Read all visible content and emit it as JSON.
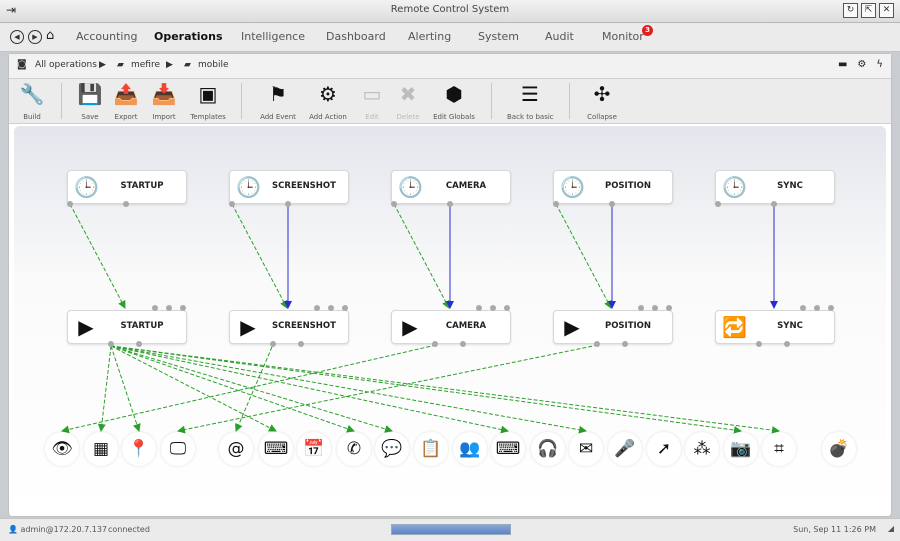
{
  "window": {
    "title": "Remote Control System",
    "controls": [
      "↻",
      "⇱",
      "✕"
    ]
  },
  "menu": {
    "tabs": [
      "Accounting",
      "Operations",
      "Intelligence",
      "Dashboard",
      "Alerting",
      "System",
      "Audit",
      "Monitor"
    ],
    "active": "Operations",
    "monitor_badge": "3"
  },
  "breadcrumb": {
    "root": "All operations",
    "operation": "mefire",
    "target": "mobile"
  },
  "toolbar": {
    "items": [
      {
        "label": "Build",
        "icon": "wrench-icon",
        "enabled": true
      },
      {
        "label": "Save",
        "icon": "floppy-icon",
        "enabled": true
      },
      {
        "label": "Export",
        "icon": "export-icon",
        "enabled": true
      },
      {
        "label": "Import",
        "icon": "import-icon",
        "enabled": true
      },
      {
        "label": "Templates",
        "icon": "templates-icon",
        "enabled": true
      },
      {
        "label": "Add Event",
        "icon": "flag-add-icon",
        "enabled": true
      },
      {
        "label": "Add Action",
        "icon": "gear-add-icon",
        "enabled": true
      },
      {
        "label": "Edit",
        "icon": "edit-icon",
        "enabled": false
      },
      {
        "label": "Delete",
        "icon": "delete-icon",
        "enabled": false
      },
      {
        "label": "Edit Globals",
        "icon": "cube-icon",
        "enabled": true
      },
      {
        "label": "Back to basic",
        "icon": "list-icon",
        "enabled": true
      },
      {
        "label": "Collapse",
        "icon": "collapse-icon",
        "enabled": true
      }
    ]
  },
  "events": [
    "STARTUP",
    "SCREENSHOT",
    "CAMERA",
    "POSITION",
    "SYNC"
  ],
  "actions": [
    "STARTUP",
    "SCREENSHOT",
    "CAMERA",
    "POSITION",
    "SYNC"
  ],
  "modules": [
    {
      "icon": "eye-icon",
      "glyph": "👁"
    },
    {
      "icon": "chip-icon",
      "glyph": "▦"
    },
    {
      "icon": "map-pin-icon",
      "glyph": "📍"
    },
    {
      "icon": "monitor-icon",
      "glyph": "🖵"
    },
    {
      "icon": "address-book-icon",
      "glyph": "@"
    },
    {
      "icon": "terminal-icon",
      "glyph": "⌨"
    },
    {
      "icon": "calendar-icon",
      "glyph": "📅"
    },
    {
      "icon": "phone-icon",
      "glyph": "✆"
    },
    {
      "icon": "chat-icon",
      "glyph": "💬"
    },
    {
      "icon": "clipboard-icon",
      "glyph": "📋"
    },
    {
      "icon": "contacts-icon",
      "glyph": "👥"
    },
    {
      "icon": "keyboard-icon",
      "glyph": "⌨"
    },
    {
      "icon": "headset-icon",
      "glyph": "🎧"
    },
    {
      "icon": "mail-icon",
      "glyph": "✉"
    },
    {
      "icon": "microphone-icon",
      "glyph": "🎤"
    },
    {
      "icon": "cursor-icon",
      "glyph": "➚"
    },
    {
      "icon": "password-icon",
      "glyph": "⁂"
    },
    {
      "icon": "camera-icon",
      "glyph": "📷"
    },
    {
      "icon": "url-icon",
      "glyph": "⌗"
    },
    {
      "icon": "bomb-icon",
      "glyph": "💣"
    }
  ],
  "status": {
    "user": "admin@172.20.7.137",
    "connection": "connected",
    "progress": 1.0,
    "datetime": "Sun, Sep 11 1:26 PM"
  },
  "colors": {
    "event_link": "#2b9f2b",
    "action_link": "#2b2bd6"
  }
}
